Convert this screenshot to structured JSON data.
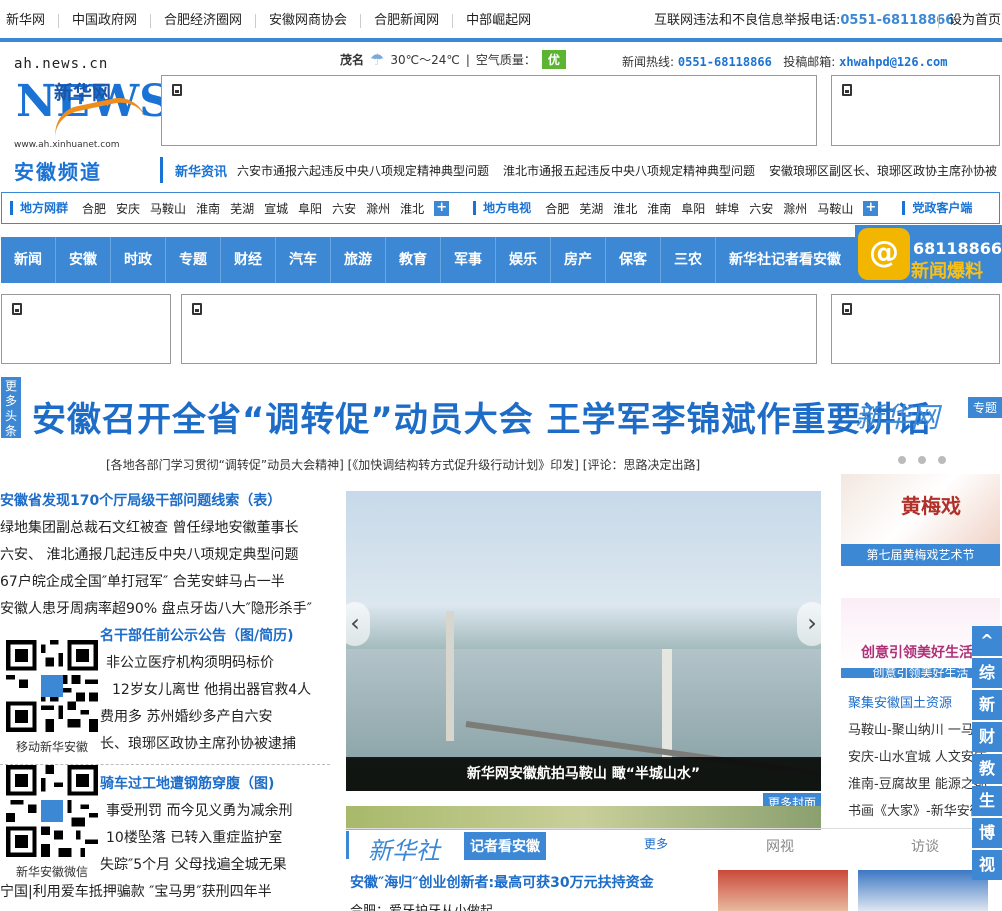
{
  "topbar": {
    "links": [
      "新华网",
      "中国政府网",
      "合肥经济圈网",
      "安徽网商协会",
      "合肥新闻网",
      "中部崛起网"
    ],
    "report_label": "互联网违法和不良信息举报电话:",
    "report_phone": "0551-68118866",
    "set_home": "设为首页"
  },
  "logo": {
    "domain": "ah.news.cn",
    "name": "新华网",
    "letters": "NEWS",
    "url": "www.ah.xinhuanet.com",
    "channel": "安徽频道"
  },
  "weather": {
    "city": "茂名",
    "temp": "30℃～24℃",
    "aq_label": "空气质量：",
    "aq_value": "优"
  },
  "hotline": {
    "tel_label": "新闻热线:",
    "tel": "0551-68118866",
    "mail_label": "投稿邮箱:",
    "mail": "xhwahpd@126.com"
  },
  "newsline": {
    "tag": "新华资讯",
    "items": [
      "六安市通报六起违反中央八项规定精神典型问题",
      "淮北市通报五起违反中央八项规定精神典型问题",
      "安徽琅琊区副区长、琅琊区政协主席孙协被"
    ]
  },
  "regionbar": {
    "web_label": "地方网群",
    "web_cities": [
      "合肥",
      "安庆",
      "马鞍山",
      "淮南",
      "芜湖",
      "宣城",
      "阜阳",
      "六安",
      "滁州",
      "淮北"
    ],
    "tv_label": "地方电视",
    "tv_cities": [
      "合肥",
      "芜湖",
      "淮北",
      "淮南",
      "阜阳",
      "蚌埠",
      "六安",
      "滁州",
      "马鞍山"
    ],
    "party_label": "党政客户端",
    "plus": "+"
  },
  "mainnav": [
    "新闻",
    "安徽",
    "时政",
    "专题",
    "财经",
    "汽车",
    "旅游",
    "教育",
    "军事",
    "娱乐",
    "房产",
    "保客",
    "三农",
    "新华社记者看安徽"
  ],
  "hotnews": {
    "icon": "@",
    "number": "68118866",
    "label": "新闻爆料"
  },
  "headline": {
    "more": "更多头条",
    "title": "安徽召开全省“调转促”动员大会 王学军李锦斌作重要讲话",
    "xinhua": "新华网",
    "topic": "专题",
    "sublinks": "[各地各部门学习贯彻“调转促”动员大会精神] [《加快调结构转方式促升级行动计划》印发] [评论：思路决定出路]"
  },
  "leftcol": {
    "h1": "安徽省发现170个厅局级干部问题线索（表）",
    "list1": [
      "绿地集团副总裁石文红被查 曾任绿地安徽董事长",
      "六安、 淮北通报几起违反中央八项规定典型问题",
      "67户皖企成全国″单打冠军″ 合芜安蚌马占一半",
      "安徽人患牙周病率超90% 盘点牙齿八大″隐形杀手″"
    ],
    "h2": "名干部任前公示公告（图/简历)",
    "list2": [
      "非公立医疗机构须明码标价",
      "12岁女儿离世 他捐出器官救4人",
      "费用多 苏州婚纱多产自六安",
      "长、琅琊区政协主席孙协被逮捕"
    ],
    "h3": "骑车过工地遭钢筋穿腹（图)",
    "list3": [
      "事受刑罚 而今见义勇为减余刑",
      "10楼坠落 已转入重症监护室",
      "失踪″5个月 父母找遍全城无果",
      "宁国|利用爱车抵押骗款 ″宝马男″获刑四年半"
    ]
  },
  "qr": {
    "cap1": "移动新华安徽",
    "cap2": "新华安徽微信"
  },
  "slide": {
    "caption": "新华网安徽航拍马鞍山 瞰“半城山水”",
    "prev": "‹",
    "next": "›",
    "more_cover": "更多封面"
  },
  "reporter": {
    "xinhua": "新华社",
    "tab": "记者看安徽",
    "more": "更多",
    "tab2": "网视",
    "tab3": "访谈",
    "news1": "安徽″海归″创业创新者:最高可获30万元扶持资金",
    "news2": "合肥：爱牙护牙从小做起"
  },
  "right": {
    "card1_caption": "第七届黄梅戏艺术节",
    "card1_art": "黄梅戏",
    "card2_caption": "创意引领美好生活",
    "card2_art": "创意引领美好生活",
    "list": [
      "聚集安徽国土资源",
      "马鞍山-聚山纳川 一马当",
      "安庆-山水宜城 人文安庆",
      "淮南-豆腐故里 能源之都",
      "书画《大家》-新华安徽"
    ]
  },
  "sidenav": [
    "^",
    "综",
    "新",
    "财",
    "教",
    "生",
    "博",
    "视"
  ]
}
